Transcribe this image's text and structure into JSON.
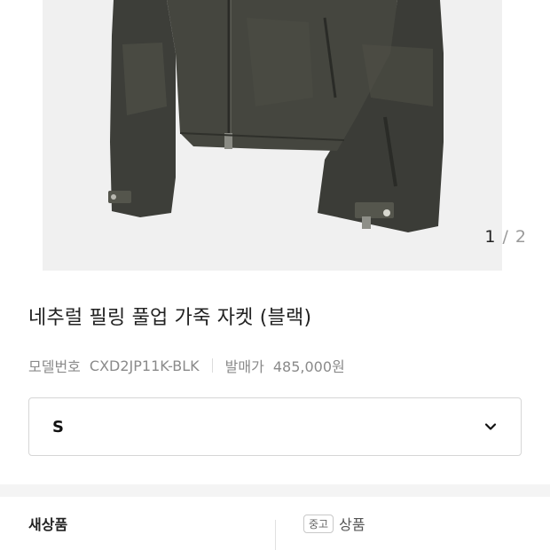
{
  "gallery": {
    "current": "1",
    "separator": "/",
    "total": "2"
  },
  "product": {
    "title": "네추럴 필링 풀업 가죽 자켓 (블랙)",
    "model_label": "모델번호",
    "model_value": "CXD2JP11K-BLK",
    "price_label": "발매가",
    "price_value": "485,000원"
  },
  "size_select": {
    "selected": "S"
  },
  "condition_tabs": [
    {
      "label": "새상품"
    },
    {
      "badge": "중고",
      "label": "상품"
    }
  ],
  "colors": {
    "jacket": "#3f403b",
    "photo_bg": "#f0f0f0",
    "section_gap": "#f4f4f4"
  }
}
